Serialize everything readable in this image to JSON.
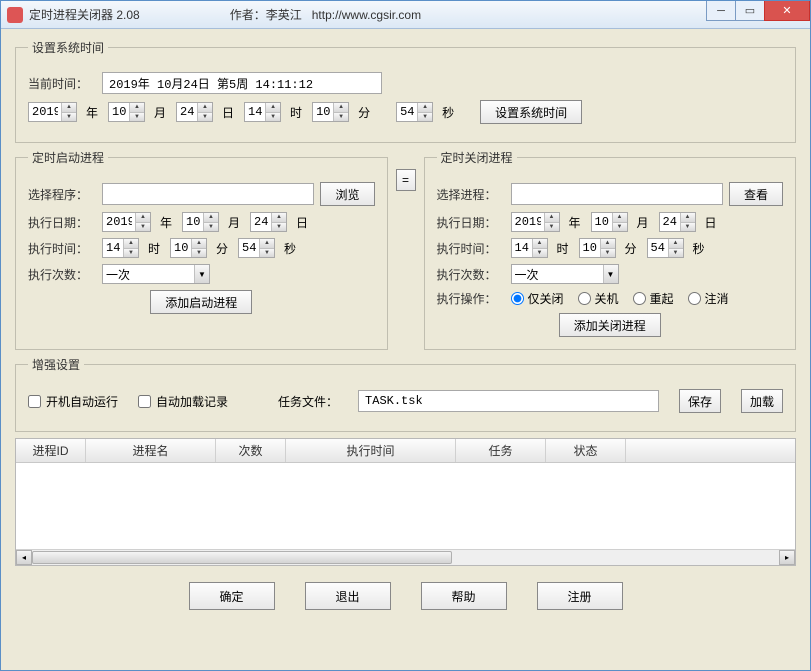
{
  "window": {
    "title": "定时进程关闭器 2.08",
    "author_prefix": "作者：李英江",
    "url": "http://www.cgsir.com"
  },
  "systime": {
    "legend": "设置系统时间",
    "current_label": "当前时间：",
    "current_value": "2019年 10月24日 第5周 14:11:12",
    "year": "2019",
    "month": "10",
    "day": "24",
    "hour": "14",
    "minute": "10",
    "second": "54",
    "unit_year": "年",
    "unit_month": "月",
    "unit_day": "日",
    "unit_hour": "时",
    "unit_minute": "分",
    "unit_second": "秒",
    "set_btn": "设置系统时间"
  },
  "start": {
    "legend": "定时启动进程",
    "select_label": "选择程序：",
    "browse_btn": "浏览",
    "date_label": "执行日期：",
    "year": "2019",
    "month": "10",
    "day": "24",
    "time_label": "执行时间：",
    "hour": "14",
    "minute": "10",
    "second": "54",
    "times_label": "执行次数：",
    "times_value": "一次",
    "add_btn": "添加启动进程"
  },
  "close": {
    "legend": "定时关闭进程",
    "select_label": "选择进程：",
    "view_btn": "查看",
    "date_label": "执行日期：",
    "year": "2019",
    "month": "10",
    "day": "24",
    "time_label": "执行时间：",
    "hour": "14",
    "minute": "10",
    "second": "54",
    "times_label": "执行次数：",
    "times_value": "一次",
    "action_label": "执行操作：",
    "actions": {
      "close_only": "仅关闭",
      "shutdown": "关机",
      "restart": "重起",
      "logoff": "注消"
    },
    "add_btn": "添加关闭进程"
  },
  "enhance": {
    "legend": "增强设置",
    "autostart": "开机自动运行",
    "autoload": "自动加载记录",
    "task_label": "任务文件：",
    "task_value": "TASK.tsk",
    "save_btn": "保存",
    "load_btn": "加载"
  },
  "table": {
    "cols": {
      "id": "进程ID",
      "name": "进程名",
      "times": "次数",
      "exectime": "执行时间",
      "task": "任务",
      "status": "状态"
    }
  },
  "buttons": {
    "ok": "确定",
    "exit": "退出",
    "help": "帮助",
    "register": "注册"
  },
  "eq": "="
}
